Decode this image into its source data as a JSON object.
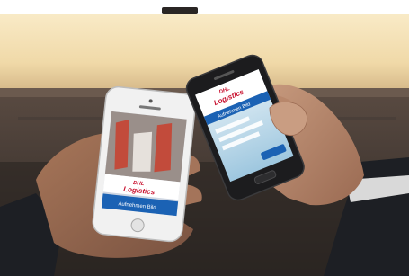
{
  "photo": {
    "subject": "Two hands holding smartphones displaying a logistics app",
    "iphone_screen": {
      "brand_mark": "DHL",
      "brand_name": "Logistics",
      "footer_bar": "Aufnehmen Bild"
    },
    "android_screen": {
      "brand_mark": "DHL",
      "brand_name": "Logistics",
      "header_bar": "Aufnehmen Bild"
    },
    "colors": {
      "ceiling_light": "#f2dfb3",
      "background_dark": "#3a3431",
      "skin": "#b9876a",
      "sleeve": "#1d1f24",
      "brand_red": "#c8102e",
      "brand_blue": "#1b62b4"
    }
  }
}
